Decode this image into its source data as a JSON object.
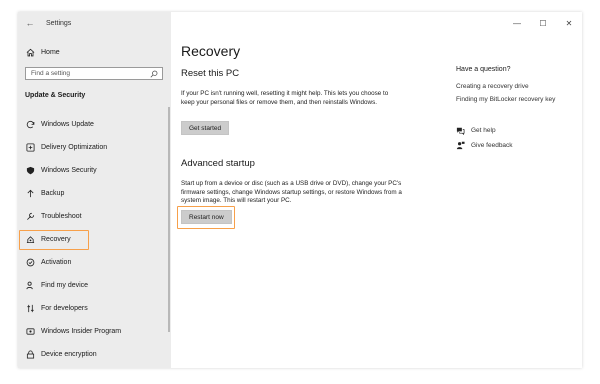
{
  "window": {
    "title": "Settings",
    "back_glyph": "←"
  },
  "sidebar": {
    "home_label": "Home",
    "search_placeholder": "Find a setting",
    "section_title": "Update & Security",
    "items": [
      {
        "label": "Windows Update",
        "icon": "refresh-icon"
      },
      {
        "label": "Delivery Optimization",
        "icon": "delivery-icon"
      },
      {
        "label": "Windows Security",
        "icon": "shield-icon"
      },
      {
        "label": "Backup",
        "icon": "backup-arrow-icon"
      },
      {
        "label": "Troubleshoot",
        "icon": "wrench-icon"
      },
      {
        "label": "Recovery",
        "icon": "recovery-icon"
      },
      {
        "label": "Activation",
        "icon": "check-circle-icon"
      },
      {
        "label": "Find my device",
        "icon": "person-pin-icon"
      },
      {
        "label": "For developers",
        "icon": "developer-icon"
      },
      {
        "label": "Windows Insider Program",
        "icon": "insider-icon"
      },
      {
        "label": "Device encryption",
        "icon": "lock-icon"
      }
    ],
    "selected": "Recovery"
  },
  "main": {
    "title": "Recovery",
    "reset": {
      "heading": "Reset this PC",
      "description": "If your PC isn't running well, resetting it might help. This lets you choose to keep your personal files or remove them, and then reinstalls Windows.",
      "button_label": "Get started"
    },
    "advanced": {
      "heading": "Advanced startup",
      "description": "Start up from a device or disc (such as a USB drive or DVD), change your PC's firmware settings, change Windows startup settings, or restore Windows from a system image. This will restart your PC.",
      "button_label": "Restart now"
    }
  },
  "help_panel": {
    "title": "Have a question?",
    "links": [
      "Creating a recovery drive",
      "Finding my BitLocker recovery key"
    ],
    "get_help": "Get help",
    "give_feedback": "Give feedback"
  },
  "window_controls": {
    "minimize": "—",
    "maximize": "☐",
    "close": "✕"
  },
  "colors": {
    "highlight": "#f7a04a",
    "sidebar_bg": "#ececec",
    "button_bg": "#cccccc"
  }
}
